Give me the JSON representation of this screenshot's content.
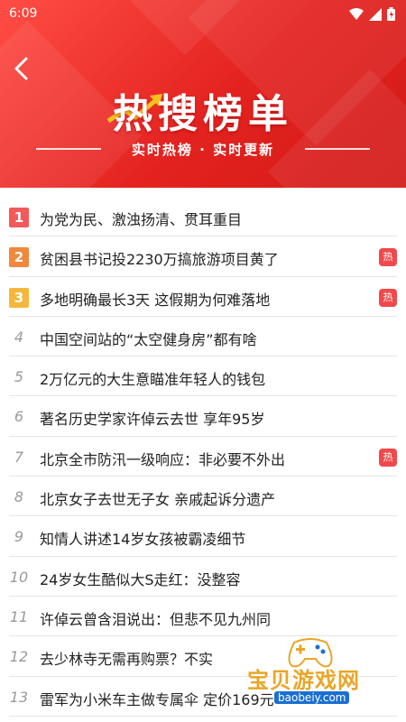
{
  "status_bar": {
    "time": "6:09"
  },
  "header": {
    "title": "热搜榜单",
    "subtitle": "实时热榜 · 实时更新"
  },
  "hot_label": "热",
  "list": [
    {
      "rank": "1",
      "text": "为党为民、激浊扬清、贯耳重目",
      "hot": false
    },
    {
      "rank": "2",
      "text": "贫困县书记投2230万搞旅游项目黄了",
      "hot": true
    },
    {
      "rank": "3",
      "text": "多地明确最长3天 这假期为何难落地",
      "hot": true
    },
    {
      "rank": "4",
      "text": "中国空间站的“太空健身房”都有啥",
      "hot": false
    },
    {
      "rank": "5",
      "text": "2万亿元的大生意瞄准年轻人的钱包",
      "hot": false
    },
    {
      "rank": "6",
      "text": "著名历史学家许倬云去世 享年95岁",
      "hot": false
    },
    {
      "rank": "7",
      "text": "北京全市防汛一级响应：非必要不外出",
      "hot": true
    },
    {
      "rank": "8",
      "text": "北京女子去世无子女 亲戚起诉分遗产",
      "hot": false
    },
    {
      "rank": "9",
      "text": "知情人讲述14岁女孩被霸凌细节",
      "hot": false
    },
    {
      "rank": "10",
      "text": "24岁女生酷似大S走红：没整容",
      "hot": false
    },
    {
      "rank": "11",
      "text": "许倬云曾含泪说出：但悲不见九州同",
      "hot": false
    },
    {
      "rank": "12",
      "text": "去少林寺无需再购票？不实",
      "hot": false
    },
    {
      "rank": "13",
      "text": "雷军为小米车主做专属伞 定价169元",
      "hot": false
    }
  ],
  "watermark": {
    "text": "宝贝游戏网",
    "url": "baobeiy.com"
  },
  "colors": {
    "banner": "#e3221f",
    "rank1": "#f25a5a",
    "rank2": "#f2883c",
    "rank3": "#f5b73b",
    "hot_badge": "#f0494b"
  },
  "icons": [
    "wifi-icon",
    "signal-icon",
    "battery-icon",
    "back-arrow-icon"
  ]
}
